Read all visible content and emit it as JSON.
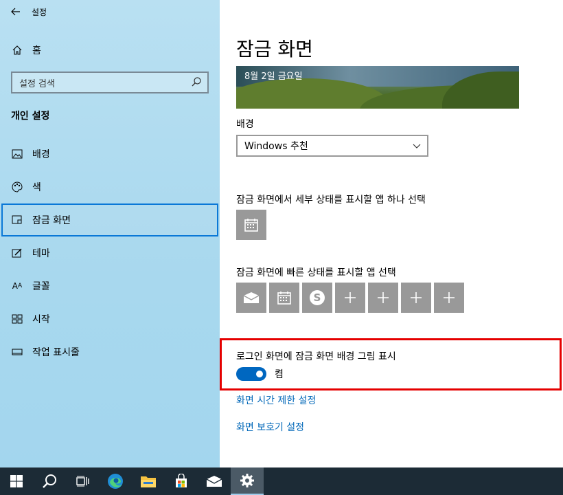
{
  "window": {
    "title": "설정",
    "back_label": "←"
  },
  "sidebar": {
    "home_label": "홈",
    "search_placeholder": "설정 검색",
    "section_title": "개인 설정",
    "items": [
      {
        "label": "배경",
        "icon": "picture-icon"
      },
      {
        "label": "색",
        "icon": "palette-icon"
      },
      {
        "label": "잠금 화면",
        "icon": "lock-screen-icon",
        "selected": true
      },
      {
        "label": "테마",
        "icon": "theme-icon"
      },
      {
        "label": "글꼴",
        "icon": "font-icon"
      },
      {
        "label": "시작",
        "icon": "start-icon"
      },
      {
        "label": "작업 표시줄",
        "icon": "taskbar-icon"
      }
    ]
  },
  "main": {
    "title": "잠금 화면",
    "preview_date": "8월 2일 금요일",
    "background_label": "배경",
    "background_value": "Windows 추천",
    "detailed_status_label": "잠금 화면에서 세부 상태를 표시할 앱 하나 선택",
    "quick_status_label": "잠금 화면에 빠른 상태를 표시할 앱 선택",
    "quick_status_tiles": [
      "mail-icon",
      "calendar-icon",
      "skype-icon",
      "plus-icon",
      "plus-icon",
      "plus-icon",
      "plus-icon"
    ],
    "signin_label": "로그인 화면에 잠금 화면 배경 그림 표시",
    "signin_toggle_state": "켬",
    "signin_toggle_on": true,
    "link_timeout": "화면 시간 제한 설정",
    "link_screensaver": "화면 보호기 설정"
  },
  "taskbar": {
    "buttons": [
      "windows-start-icon",
      "search-icon",
      "task-view-icon",
      "edge-icon",
      "file-explorer-icon",
      "store-icon",
      "mail-icon",
      "settings-gear-icon"
    ],
    "active": "settings-gear-icon"
  },
  "colors": {
    "accent": "#0067c0",
    "highlight": "#e50000",
    "sidebar": "#a8d8ee",
    "taskbar": "#1c2b36",
    "tile": "#999999"
  }
}
